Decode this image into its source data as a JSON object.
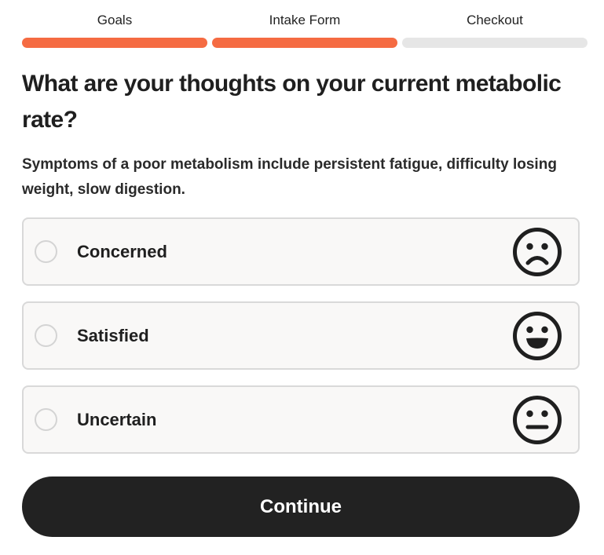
{
  "progress": {
    "steps": [
      {
        "label": "Goals",
        "completed": true
      },
      {
        "label": "Intake Form",
        "completed": true
      },
      {
        "label": "Checkout",
        "completed": false
      }
    ],
    "accent_color": "#f56b42",
    "inactive_color": "#e6e6e6"
  },
  "question": {
    "title": "What are your thoughts on your current metabolic rate?",
    "subtitle": "Symptoms of a poor metabolism include persistent fatigue, difficulty losing weight, slow digestion."
  },
  "options": [
    {
      "label": "Concerned",
      "icon": "frown-face-icon",
      "selected": false
    },
    {
      "label": "Satisfied",
      "icon": "smile-face-icon",
      "selected": false
    },
    {
      "label": "Uncertain",
      "icon": "neutral-face-icon",
      "selected": false
    }
  ],
  "actions": {
    "continue_label": "Continue",
    "button_color": "#222222"
  }
}
